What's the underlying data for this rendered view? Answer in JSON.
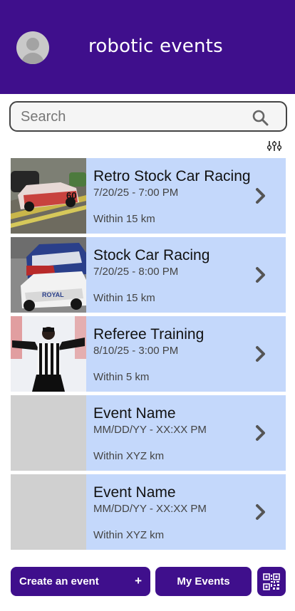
{
  "header": {
    "title": "robotic events",
    "avatar_icon": "user-avatar-icon"
  },
  "search": {
    "placeholder": "Search"
  },
  "filter": {
    "icon": "sliders-icon"
  },
  "events": [
    {
      "title": "Retro Stock Car Racing",
      "datetime": "7/20/25 - 7:00 PM",
      "distance": "Within 15 km",
      "image": "retro-stock-car-photo"
    },
    {
      "title": "Stock Car Racing",
      "datetime": "7/20/25 - 8:00 PM",
      "distance": "Within 15 km",
      "image": "stock-car-photo"
    },
    {
      "title": "Referee Training",
      "datetime": "8/10/25 - 3:00 PM",
      "distance": "Within 5 km",
      "image": "referee-photo"
    },
    {
      "title": "Event Name",
      "datetime": "MM/DD/YY - XX:XX PM",
      "distance": "Within XYZ km",
      "image": "placeholder"
    },
    {
      "title": "Event Name",
      "datetime": "MM/DD/YY - XX:XX PM",
      "distance": "Within XYZ km",
      "image": "placeholder"
    }
  ],
  "footer": {
    "create_label": "Create an event",
    "create_plus": "+",
    "my_events_label": "My Events",
    "qr_icon": "qr-code-icon"
  },
  "colors": {
    "primary": "#3f0f8c",
    "card": "#c4d8fb",
    "placeholder": "#d0d0d0"
  }
}
